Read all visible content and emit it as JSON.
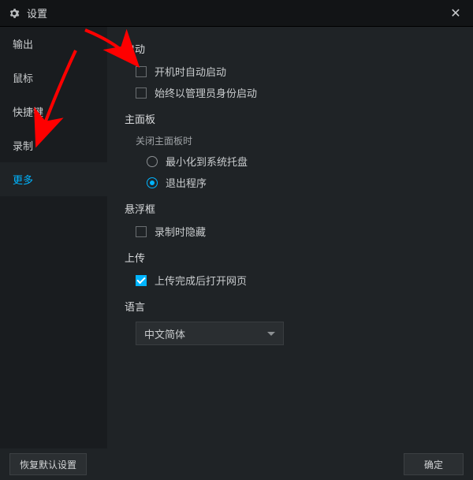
{
  "window": {
    "title": "设置"
  },
  "sidebar": {
    "items": [
      {
        "label": "输出"
      },
      {
        "label": "鼠标"
      },
      {
        "label": "快捷键"
      },
      {
        "label": "录制"
      },
      {
        "label": "更多"
      }
    ],
    "active_index": 4
  },
  "sections": {
    "startup": {
      "title": "启动",
      "autostart_label": "开机时自动启动",
      "admin_label": "始终以管理员身份启动"
    },
    "mainpanel": {
      "title": "主面板",
      "close_behavior_title": "关闭主面板时",
      "minimize_label": "最小化到系统托盘",
      "exit_label": "退出程序",
      "selected": "exit"
    },
    "floatbox": {
      "title": "悬浮框",
      "hide_on_record_label": "录制时隐藏"
    },
    "upload": {
      "title": "上传",
      "open_web_label": "上传完成后打开网页",
      "open_web_checked": true
    },
    "language": {
      "title": "语言",
      "selected_label": "中文简体"
    }
  },
  "footer": {
    "restore_label": "恢复默认设置",
    "ok_label": "确定"
  }
}
